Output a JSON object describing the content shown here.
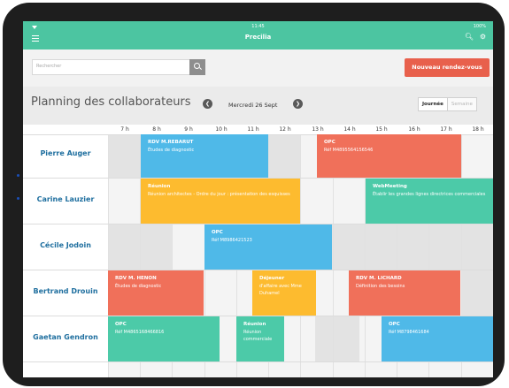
{
  "statusbar": {
    "time": "11:45",
    "battery": "100%"
  },
  "app": {
    "title": "Precilia"
  },
  "header_icons": {
    "search_icon": "search-icon",
    "settings_icon": "gear-icon",
    "menu_icon": "menu-icon"
  },
  "search": {
    "placeholder": "Rechercher"
  },
  "new_button": {
    "label": "Nouveau rendez-vous"
  },
  "planning": {
    "title": "Planning des collaborateurs",
    "date": "Mercredi 26 Sept",
    "view_day": "Journée",
    "view_week": "Semaine"
  },
  "hours": [
    "7 h",
    "8 h",
    "9 h",
    "10 h",
    "11 h",
    "12 h",
    "13 h",
    "14 h",
    "15 h",
    "16 h",
    "17 h",
    "18 h"
  ],
  "collaborators": [
    "Pierre Auger",
    "Carine Lauzier",
    "Cécile Jodoin",
    "Bertrand Drouin",
    "Gaetan Gendron"
  ],
  "events": [
    {
      "title": "RDV M.REBARUT",
      "subtitle": "Études de diagnostic",
      "color": "#4fb9e8"
    },
    {
      "title": "OPC",
      "subtitle": "Réf M4895564156546",
      "color": "#f0705a"
    },
    {
      "title": "Réunion",
      "subtitle": "Réunion architectes - Ordre du jour : présentation des esquisses",
      "color": "#fdbb2f"
    },
    {
      "title": "WebMeeting",
      "subtitle": "Établir les grandes lignes directrices commerciales",
      "color": "#4ccaa8"
    },
    {
      "title": "OPC",
      "subtitle": "Réf M8986421523",
      "color": "#4fb9e8"
    },
    {
      "title": "RDV M. HENON",
      "subtitle": "Études de diagnostic",
      "color": "#f0705a"
    },
    {
      "title": "Déjeuner",
      "subtitle": "d'affaire avec Mme Duhamel",
      "color": "#fdbb2f"
    },
    {
      "title": "RDV M. LICHARD",
      "subtitle": "Définition des besoins",
      "color": "#f0705a"
    },
    {
      "title": "OPC",
      "subtitle": "Réf M4865168466816",
      "color": "#4ccaa8"
    },
    {
      "title": "Réunion",
      "subtitle": "Réunion commerciale",
      "color": "#4ccaa8"
    },
    {
      "title": "OPC",
      "subtitle": "Réf M8798461684",
      "color": "#4fb9e8"
    }
  ]
}
